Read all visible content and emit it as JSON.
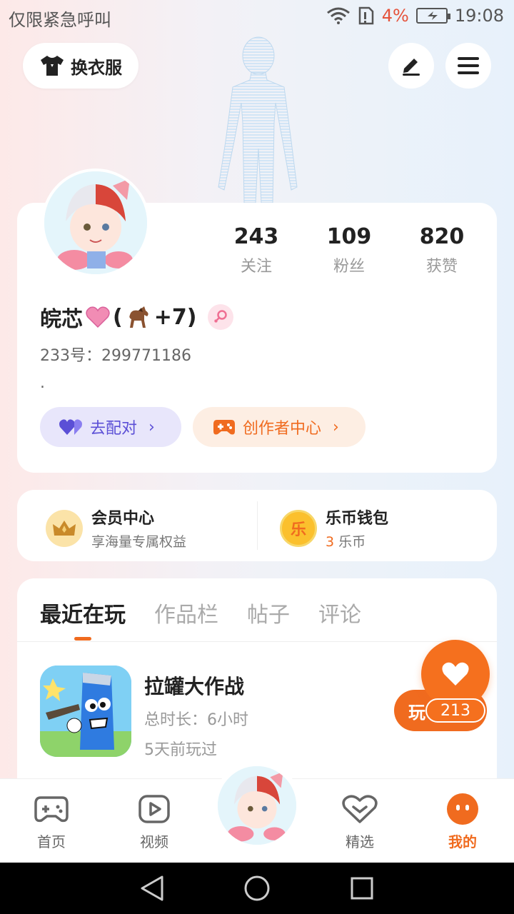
{
  "status_bar": {
    "carrier": "仅限紧急呼叫",
    "battery_pct": "4%",
    "time": "19:08",
    "icons": [
      "wifi-icon",
      "sim-icon",
      "battery-charging-icon"
    ]
  },
  "header": {
    "outfit_label": "换衣服",
    "icons": [
      "shirt-icon",
      "edit-icon",
      "menu-icon"
    ]
  },
  "profile": {
    "stats": [
      {
        "value": "243",
        "label": "关注"
      },
      {
        "value": "109",
        "label": "粉丝"
      },
      {
        "value": "820",
        "label": "获赞"
      }
    ],
    "name_prefix": "皖芯",
    "name_suffix": "(",
    "name_tail": "+7)",
    "uid": "233号：299771186",
    "bio": ".",
    "pair_label": "去配对",
    "creator_label": "创作者中心"
  },
  "member": {
    "vip_title": "会员中心",
    "vip_sub": "享海量专属权益",
    "wallet_title": "乐币钱包",
    "wallet_amount": "3",
    "wallet_unit": " 乐币",
    "wallet_icon_char": "乐"
  },
  "tabs": [
    {
      "label": "最近在玩",
      "active": true
    },
    {
      "label": "作品栏",
      "active": false
    },
    {
      "label": "帖子",
      "active": false
    },
    {
      "label": "评论",
      "active": false
    }
  ],
  "games": [
    {
      "title": "拉罐大作战",
      "duration": "总时长：6小时",
      "last_played": "5天前玩过",
      "action": "玩"
    }
  ],
  "like_count": "213",
  "bottom_nav": [
    {
      "label": "首页",
      "icon": "gamepad-icon"
    },
    {
      "label": "视频",
      "icon": "video-icon"
    },
    {
      "label": "精选",
      "icon": "heart-diamond-icon"
    },
    {
      "label": "我的",
      "icon": "profile-dots-icon",
      "active": true
    }
  ],
  "colors": {
    "accent": "#f06b1f",
    "pair": "#5b4fd6",
    "battery_low": "#e5533b"
  }
}
